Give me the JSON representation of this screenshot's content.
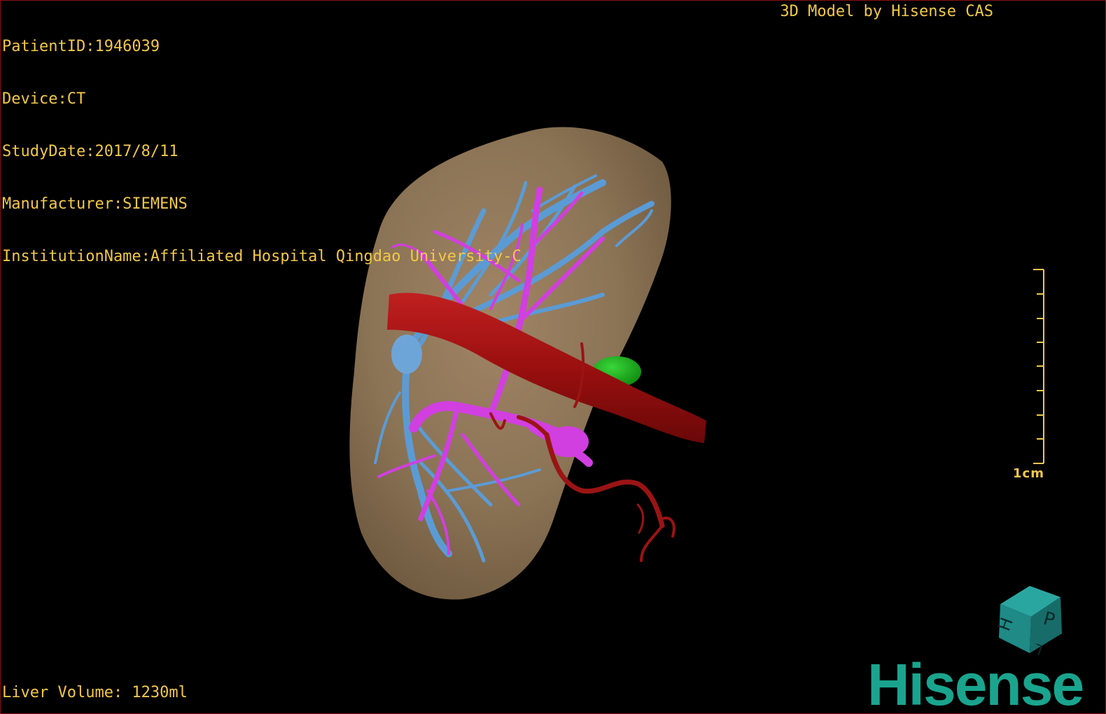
{
  "overlay": {
    "patient_id": "PatientID:1946039",
    "device": "Device:CT",
    "study_date": "StudyDate:2017/8/11",
    "manufacturer": "Manufacturer:SIEMENS",
    "institution": "InstitutionName:Affiliated Hospital Qingdao University-C",
    "credit": "3D Model by Hisense CAS",
    "liver_volume": "Liver Volume: 1230ml"
  },
  "scale_bar": {
    "label": "1cm"
  },
  "orientation_cube": {
    "face_labels": [
      "P",
      "H",
      "L"
    ]
  },
  "brand": {
    "logo_text": "Hisense"
  },
  "colors": {
    "overlay_text": "#f2c84b",
    "liver": "#8b7355",
    "portal_vein": "#d13fe0",
    "hepatic_vein": "#5b9bd5",
    "vena_cava": "#a01010",
    "artery": "#9a1414",
    "gallbladder": "#1db31d",
    "brand": "#1aa48e",
    "frame": "#8a1010"
  }
}
